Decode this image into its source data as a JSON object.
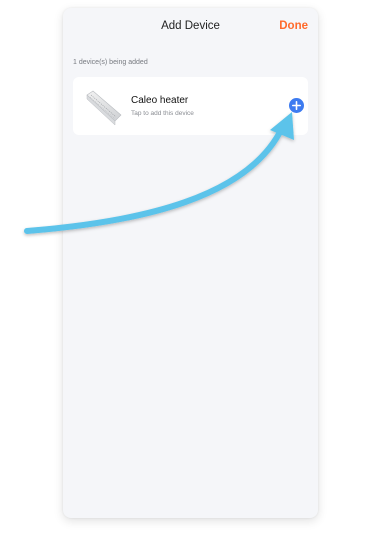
{
  "header": {
    "title": "Add Device",
    "done_label": "Done"
  },
  "section": {
    "label": "1 device(s) being added"
  },
  "devices": [
    {
      "name": "Caleo heater",
      "subtitle": "Tap to add this device",
      "icon": "heater-panel-image",
      "action_icon": "plus-icon"
    }
  ],
  "colors": {
    "accent_done": "#ff6a2c",
    "add_button": "#3d7bf0",
    "arrow": "#5bc3ea"
  }
}
